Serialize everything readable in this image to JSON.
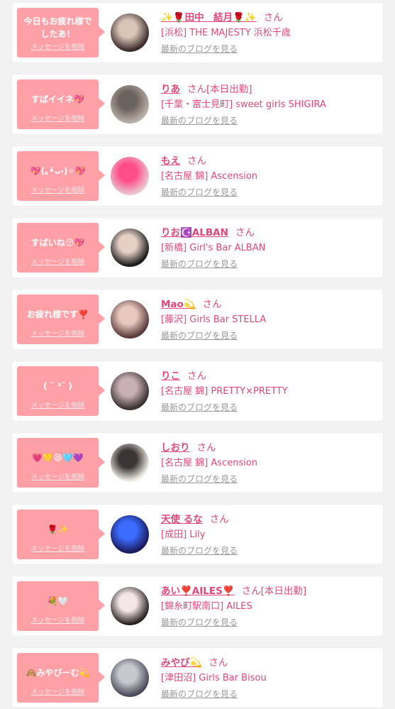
{
  "colors": {
    "bubble": "#ff9fa6",
    "accent": "#e0477a",
    "link_gray": "#999999",
    "background": "#f2f2f2"
  },
  "delete_label": "メッセージを削除",
  "blog_label": "最新のブログを見る",
  "san_label": "さん",
  "items": [
    {
      "message": "今日もお疲れ様でしたあ！",
      "name": "✨🌹田中　結月🌹✨",
      "tag": "",
      "shop": "[浜松] THE MAJESTY 浜松千歳",
      "avatar_colors": [
        "#3a2a2a",
        "#d9c4b8"
      ]
    },
    {
      "message": "すばイイネ💖",
      "name": "りあ",
      "tag": "[本日出勤]",
      "shop": "[千葉・富士見町] sweet girls SHIGIRA",
      "avatar_colors": [
        "#b8b0a8",
        "#6a625c"
      ]
    },
    {
      "message": "💖(｡•̀ᴗ-)✧💖",
      "name": "もえ",
      "tag": "",
      "shop": "[名古屋 錦] Ascension",
      "avatar_colors": [
        "#e8c6d0",
        "#ff4d8a"
      ]
    },
    {
      "message": "すばいね😚💖",
      "name": "りお☪️ALBAN",
      "tag": "",
      "shop": "[新橋] Girl's Bar ALBAN",
      "avatar_colors": [
        "#1a1a1a",
        "#e6d0c6"
      ]
    },
    {
      "message": "お疲れ様です❣️",
      "name": "Mao💫",
      "tag": "",
      "shop": "[藤沢] Girls Bar STELLA",
      "avatar_colors": [
        "#5a3a38",
        "#e8c8c0"
      ]
    },
    {
      "message": "( ˘ ³˘ )",
      "name": "りこ",
      "tag": "",
      "shop": "[名古屋 錦] PRETTY×PRETTY",
      "avatar_colors": [
        "#3a3030",
        "#c8b0b4"
      ]
    },
    {
      "message": "💗💛😆🩵💜",
      "name": "しおり",
      "tag": "",
      "shop": "[名古屋 錦] Ascension",
      "avatar_colors": [
        "#f0ede6",
        "#3a3434"
      ]
    },
    {
      "message": "🌹✨",
      "name": "天使 るな",
      "tag": "",
      "shop": "[成田] Lily",
      "avatar_colors": [
        "#1a1a5a",
        "#3c6cff"
      ]
    },
    {
      "message": "💐🤍",
      "name": "あい❣️AILES❣️",
      "tag": "[本日出勤]",
      "shop": "[錦糸町駅南口] AILES",
      "avatar_colors": [
        "#2a2222",
        "#f2e6e6"
      ]
    },
    {
      "message": "🙈みやびーむ💫",
      "name": "みやび💫",
      "tag": "",
      "shop": "[津田沼] Girls Bar Bisou",
      "avatar_colors": [
        "#4a4a5a",
        "#c8c8d0"
      ]
    }
  ]
}
